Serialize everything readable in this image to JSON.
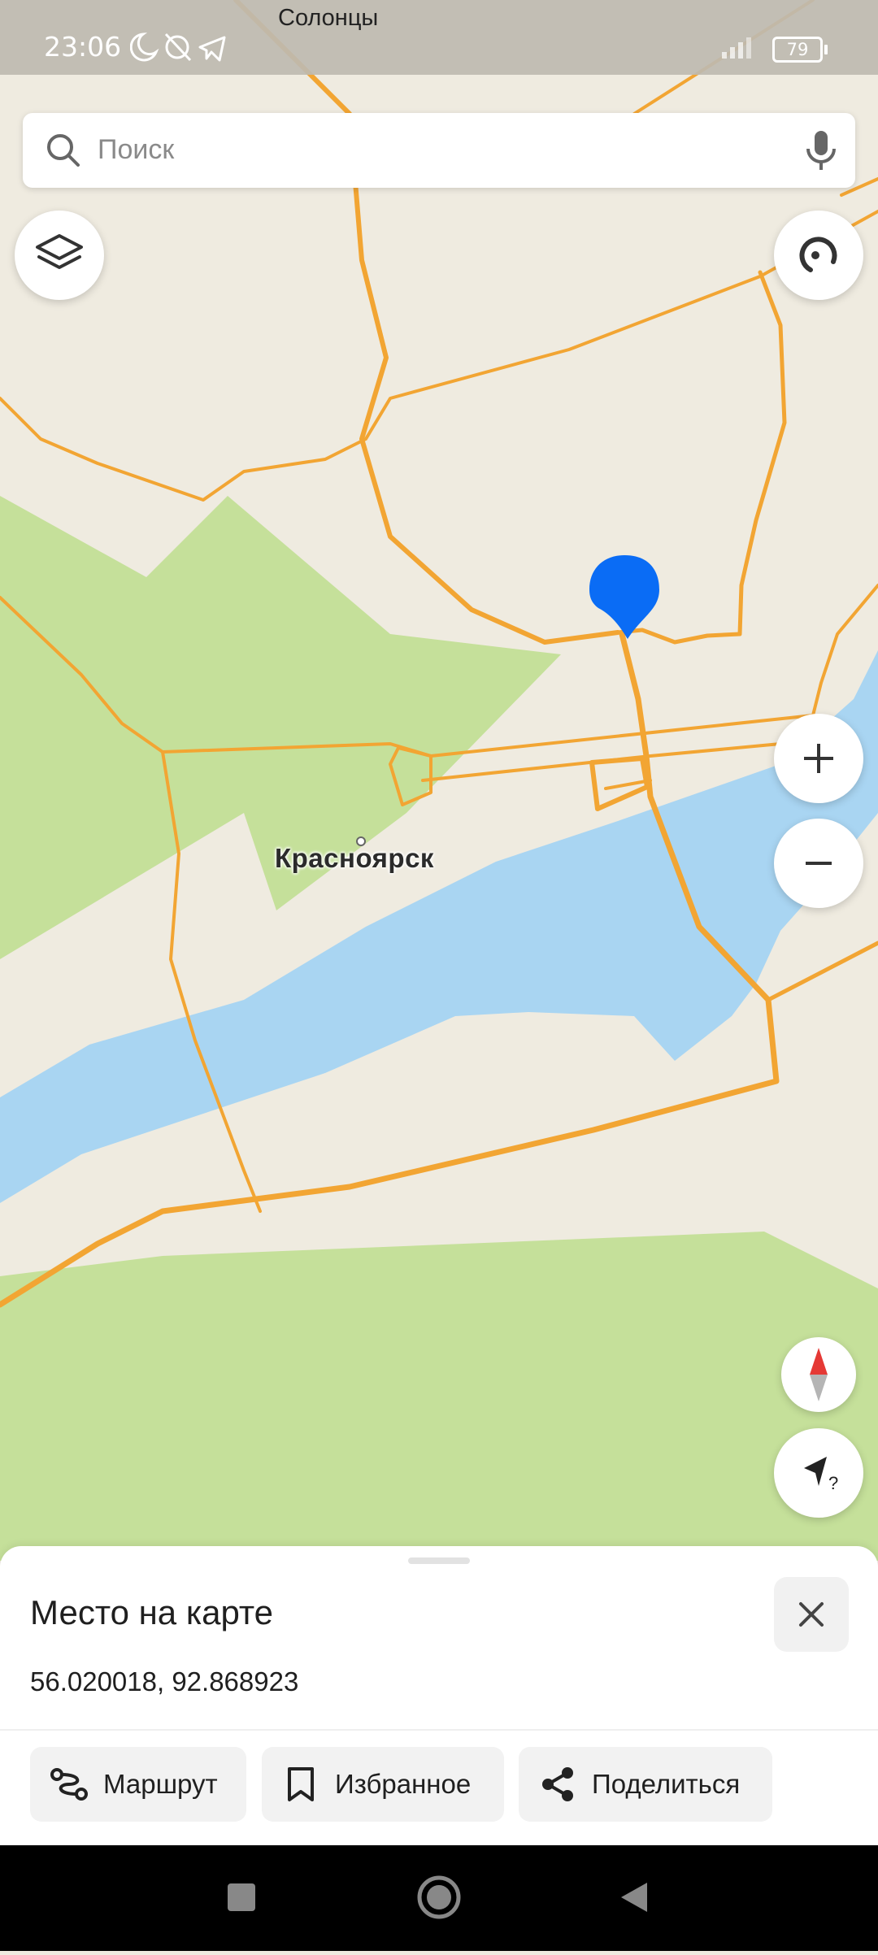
{
  "status_bar": {
    "time": "23:06",
    "place_label": "Солонцы",
    "battery": "79",
    "icons": [
      "moon-icon",
      "alarm-off-icon",
      "telegram-icon",
      "signal-icon",
      "battery-icon"
    ]
  },
  "search": {
    "placeholder": "Поиск",
    "icons": [
      "search-icon",
      "mic-icon"
    ]
  },
  "map": {
    "city_label": "Красноярск",
    "controls": [
      "layers-icon",
      "refresh-icon",
      "zoom-in-icon",
      "zoom-out-icon",
      "compass-icon",
      "locate-icon"
    ],
    "colors": {
      "background": "#efebe0",
      "forest": "#c5e09a",
      "water": "#a9d5f2",
      "road": "#f2a533",
      "pin": "#0a6cf5"
    }
  },
  "sheet": {
    "title": "Место на карте",
    "coordinates": "56.020018, 92.868923",
    "actions": [
      {
        "label": "Маршрут",
        "icon": "route-icon"
      },
      {
        "label": "Избранное",
        "icon": "bookmark-icon"
      },
      {
        "label": "Поделиться",
        "icon": "share-icon"
      }
    ]
  },
  "nav_bar": {
    "buttons": [
      "recents-icon",
      "home-icon",
      "back-icon"
    ]
  }
}
